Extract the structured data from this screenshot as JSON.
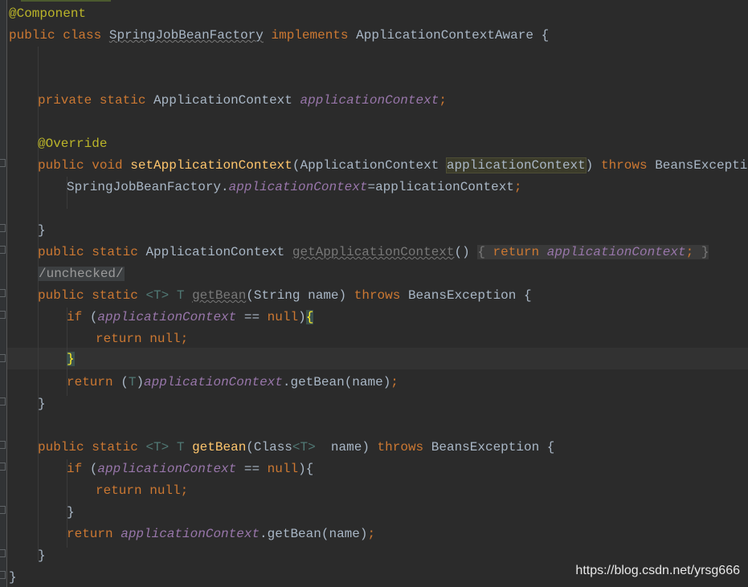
{
  "code": {
    "l1_annotation": "@Component",
    "l2_public": "public",
    "l2_class": "class",
    "l2_name": "SpringJobBeanFactory",
    "l2_implements": "implements",
    "l2_iface": "ApplicationContextAware",
    "l2_brace": "{",
    "l5_private": "private",
    "l5_static": "static",
    "l5_type": "ApplicationContext",
    "l5_field": "applicationContext",
    "l5_semi": ";",
    "l7_override": "@Override",
    "l8_public": "public",
    "l8_void": "void",
    "l8_method": "setApplicationContext",
    "l8_open": "(",
    "l8_ptype": "ApplicationContext",
    "l8_pname": "applicationContext",
    "l8_close": ")",
    "l8_throws": "throws",
    "l8_exc": "BeansException",
    "l8_brace": "{",
    "l9_class": "SpringJobBeanFactory.",
    "l9_field": "applicationContext",
    "l9_assign": "=applicationContext",
    "l9_semi": ";",
    "l11_brace": "}",
    "l12_public": "public",
    "l12_static": "static",
    "l12_type": "ApplicationContext",
    "l12_method": "getApplicationContext",
    "l12_parens": "()",
    "l12_ob": "{",
    "l12_return": "return",
    "l12_field": "applicationContext",
    "l12_semi": ";",
    "l12_cb": "}",
    "l13_chip": "/unchecked/",
    "l14_public": "public",
    "l14_static": "static",
    "l14_tparam": "<T>",
    "l14_ret": "T",
    "l14_method": "getBean",
    "l14_params": "(String name)",
    "l14_throws": "throws",
    "l14_exc": "BeansException",
    "l14_brace": "{",
    "l15_if": "if",
    "l15_open": "(",
    "l15_field": "applicationContext",
    "l15_eq": "==",
    "l15_null": "null",
    "l15_close": ")",
    "l15_brace": "{",
    "l16_return": "return",
    "l16_null": "null",
    "l16_semi": ";",
    "l17_brace": "}",
    "l18_return": "return",
    "l18_cast_open": "(",
    "l18_cast_t": "T",
    "l18_cast_close": ")",
    "l18_field": "applicationContext",
    "l18_call": ".getBean(name)",
    "l18_semi": ";",
    "l19_brace": "}",
    "l21_public": "public",
    "l21_static": "static",
    "l21_tparam": "<T>",
    "l21_ret": "T",
    "l21_method": "getBean",
    "l21_p1": "(Class",
    "l21_p2": "<T>",
    "l21_p3": "  name)",
    "l21_throws": "throws",
    "l21_exc": "BeansException",
    "l21_brace": "{",
    "l22_if": "if",
    "l22_open": "(",
    "l22_field": "applicationContext",
    "l22_eq": "==",
    "l22_null": "null",
    "l22_close": "){",
    "l23_return": "return",
    "l23_null": "null",
    "l23_semi": ";",
    "l24_brace": "}",
    "l25_return": "return",
    "l25_field": "applicationContext",
    "l25_call": ".getBean(name)",
    "l25_semi": ";",
    "l26_brace": "}",
    "l27_brace": "}"
  },
  "watermark": "https://blog.csdn.net/yrsg666",
  "colors": {
    "background": "#2b2b2b",
    "keyword": "#cc7832",
    "annotation": "#bbb529",
    "method": "#ffc66d",
    "field": "#9876aa",
    "text": "#a9b7c6"
  }
}
